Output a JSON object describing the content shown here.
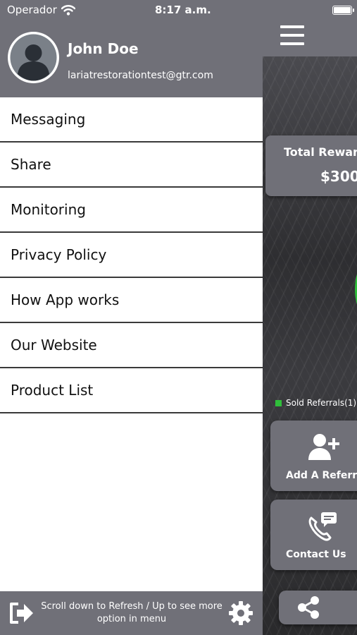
{
  "status_bar": {
    "carrier": "Operador",
    "time": "8:17 a.m."
  },
  "drawer": {
    "user_name": "John Doe",
    "user_email": "lariatrestorationtest@gtr.com",
    "menu": [
      {
        "label": "Messaging"
      },
      {
        "label": "Share"
      },
      {
        "label": "Monitoring"
      },
      {
        "label": "Privacy Policy"
      },
      {
        "label": "How App works"
      },
      {
        "label": "Our Website"
      },
      {
        "label": "Product List"
      }
    ],
    "footer_text": "Scroll down to Refresh / Up to see more option in menu"
  },
  "background": {
    "reward_title": "Total Rewar",
    "reward_value": "$300",
    "legend_label": "Sold Referrals(1)",
    "add_referral_label": "Add A Referra",
    "contact_label": "Contact Us"
  },
  "colors": {
    "header_gray": "#707078",
    "accent_green": "#2fbf3a"
  }
}
